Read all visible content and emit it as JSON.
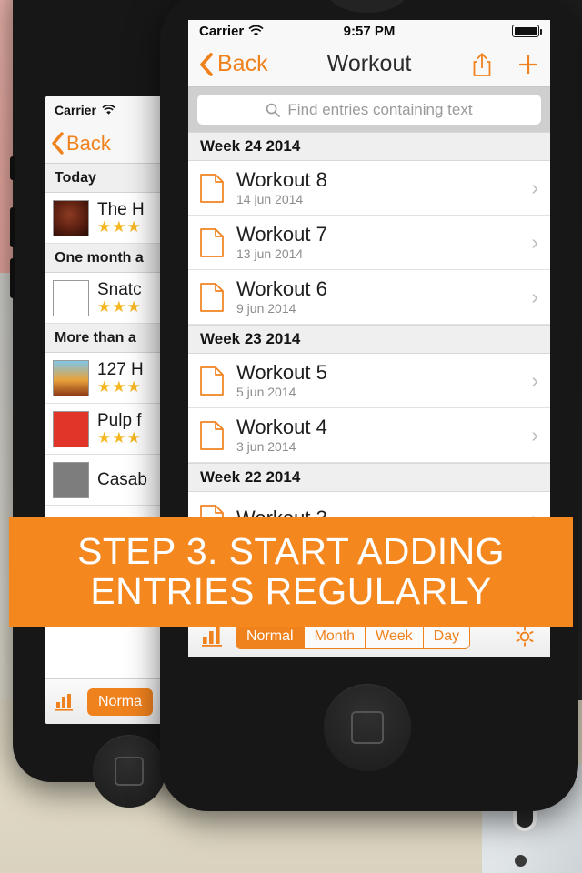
{
  "banner": {
    "line1": "STEP 3. START ADDING",
    "line2": "ENTRIES REGULARLY",
    "color": "#f5871f"
  },
  "back_phone": {
    "status": {
      "carrier": "Carrier",
      "wifi_icon": "wifi-icon"
    },
    "nav": {
      "back_label": "Back",
      "back_icon": "chevron-left-icon"
    },
    "sections": [
      {
        "header": "Today",
        "rows": [
          {
            "title": "The H",
            "stars": "★★★",
            "poster": "poster-the-hunger-games"
          }
        ]
      },
      {
        "header": "One month a",
        "rows": [
          {
            "title": "Snatc",
            "stars": "★★★",
            "poster": "poster-snatch"
          }
        ]
      },
      {
        "header": "More than a",
        "rows": [
          {
            "title": "127 H",
            "stars": "★★★",
            "poster": "poster-127-hours"
          },
          {
            "title": "Pulp f",
            "stars": "★★★",
            "poster": "poster-pulp-fiction"
          },
          {
            "title": "Casab",
            "stars": "",
            "poster": "poster-casablanca"
          }
        ]
      }
    ],
    "toolbar": {
      "chart_icon": "bar-chart-icon",
      "segment_label": "Norma"
    }
  },
  "front_phone": {
    "status": {
      "carrier": "Carrier",
      "wifi_icon": "wifi-icon",
      "time": "9:57 PM",
      "battery_icon": "battery-full-icon"
    },
    "nav": {
      "back_label": "Back",
      "back_icon": "chevron-left-icon",
      "title": "Workout",
      "share_icon": "share-icon",
      "add_icon": "plus-icon"
    },
    "search": {
      "placeholder": "Find entries containing text",
      "value": "",
      "icon": "search-icon"
    },
    "sections": [
      {
        "header": "Week 24 2014",
        "entries": [
          {
            "title": "Workout 8",
            "date": "14 jun 2014",
            "icon": "document-icon",
            "chevron": "›"
          },
          {
            "title": "Workout 7",
            "date": "13 jun 2014",
            "icon": "document-icon",
            "chevron": "›"
          },
          {
            "title": "Workout 6",
            "date": "9 jun 2014",
            "icon": "document-icon",
            "chevron": "›"
          }
        ]
      },
      {
        "header": "Week 23 2014",
        "entries": [
          {
            "title": "Workout 5",
            "date": "5 jun 2014",
            "icon": "document-icon",
            "chevron": "›"
          },
          {
            "title": "Workout 4",
            "date": "3 jun 2014",
            "icon": "document-icon",
            "chevron": "›"
          }
        ]
      },
      {
        "header": "Week 22 2014",
        "entries": [
          {
            "title": "Workout 3",
            "date": "",
            "icon": "document-icon",
            "chevron": "›"
          }
        ]
      }
    ],
    "toolbar": {
      "chart_icon": "bar-chart-icon",
      "gear_icon": "gear-icon",
      "segments": [
        {
          "label": "Normal",
          "selected": true
        },
        {
          "label": "Month",
          "selected": false
        },
        {
          "label": "Week",
          "selected": false
        },
        {
          "label": "Day",
          "selected": false
        }
      ]
    }
  },
  "theme": {
    "accent": "#f0821e",
    "banner": "#f5871f"
  }
}
